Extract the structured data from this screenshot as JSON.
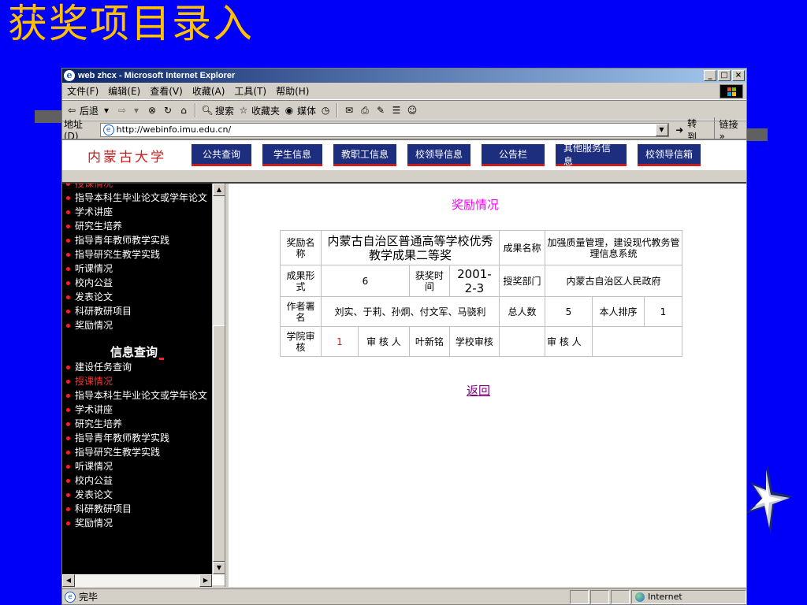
{
  "slide": {
    "title": "获奖项目录入"
  },
  "browser": {
    "window_title": "web zhcx - Microsoft Internet Explorer",
    "window_buttons": [
      "_",
      "□",
      "×"
    ],
    "menus": [
      "文件(F)",
      "编辑(E)",
      "查看(V)",
      "收藏(A)",
      "工具(T)",
      "帮助(H)"
    ],
    "toolbar": {
      "back": "后退",
      "search": "搜索",
      "favorites": "收藏夹",
      "media": "媒体"
    },
    "address": {
      "label": "地址(D)",
      "url": "http://webinfo.imu.edu.cn/",
      "go": "转到",
      "links": "链接"
    },
    "status": {
      "text": "完毕",
      "zone": "Internet"
    }
  },
  "site": {
    "logo": "内蒙古大学",
    "nav": [
      "公共查询",
      "学生信息",
      "教职工信息",
      "校领导信息",
      "公告栏",
      "其他服务信息",
      "校领导信箱"
    ]
  },
  "sidebar": {
    "top_items": [
      {
        "label": "授课情况",
        "red": true
      },
      {
        "label": "指导本科生毕业论文或学年论文",
        "red": false
      },
      {
        "label": "学术讲座",
        "red": false
      },
      {
        "label": "研究生培养",
        "red": false
      },
      {
        "label": "指导青年教师教学实践",
        "red": false
      },
      {
        "label": "指导研究生教学实践",
        "red": false
      },
      {
        "label": "听课情况",
        "red": false
      },
      {
        "label": "校内公益",
        "red": false
      },
      {
        "label": "发表论文",
        "red": false
      },
      {
        "label": "科研教研项目",
        "red": false
      },
      {
        "label": "奖励情况",
        "red": false
      }
    ],
    "section_heading": "信息查询",
    "bottom_items": [
      {
        "label": "建设任务查询",
        "red": false
      },
      {
        "label": "授课情况",
        "red": true
      },
      {
        "label": "指导本科生毕业论文或学年论文",
        "red": false
      },
      {
        "label": "学术讲座",
        "red": false
      },
      {
        "label": "研究生培养",
        "red": false
      },
      {
        "label": "指导青年教师教学实践",
        "red": false
      },
      {
        "label": "指导研究生教学实践",
        "red": false
      },
      {
        "label": "听课情况",
        "red": false
      },
      {
        "label": "校内公益",
        "red": false
      },
      {
        "label": "发表论文",
        "red": false
      },
      {
        "label": "科研教研项目",
        "red": false
      },
      {
        "label": "奖励情况",
        "red": false
      }
    ]
  },
  "main": {
    "heading": "奖励情况",
    "table": {
      "award_name_label": "奖励名称",
      "award_name_value": "内蒙古自治区普通高等学校优秀教学成果二等奖",
      "result_name_label": "成果名称",
      "result_name_value": "加强质量管理，建设现代教务管理信息系统",
      "result_form_label": "成果形式",
      "result_form_value": "6",
      "award_time_label": "获奖时间",
      "award_time_value": "2001-2-3",
      "granting_dept_label": "授奖部门",
      "granting_dept_value": "内蒙古自治区人民政府",
      "authors_label": "作者署名",
      "authors_value": "刘实、于莉、孙炯、付文军、马骁利",
      "total_people_label": "总人数",
      "total_people_value": "5",
      "rank_label": "本人排序",
      "rank_value": "1",
      "college_review_label": "学院审核",
      "college_review_value": "1",
      "reviewer_label_1": "审 核 人",
      "reviewer_value_1": "叶新铭",
      "school_review_label": "学校审核",
      "school_review_value": "",
      "reviewer_label_2": "审 核 人",
      "reviewer_value_2": ""
    },
    "return_link": "返回"
  }
}
